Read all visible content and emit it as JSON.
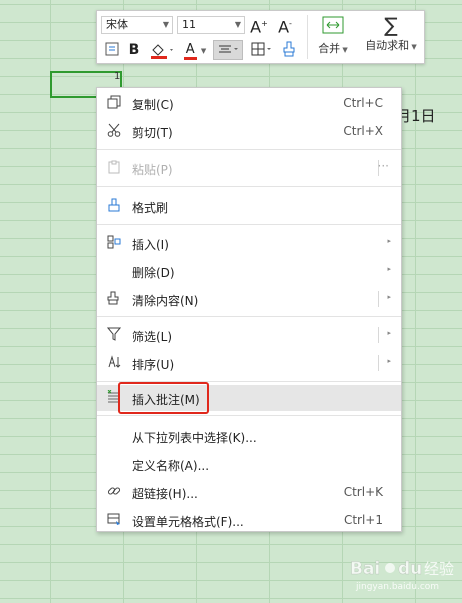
{
  "sheet": {
    "cell_value": "1",
    "visible_text": "月1日"
  },
  "mini_toolbar": {
    "font_name": "宋体",
    "font_size": "11",
    "increase_font": "A",
    "decrease_font": "A",
    "bold": "B",
    "font_color_letter": "A",
    "merge_label": "合并",
    "autosum_label": "自动求和",
    "accent_red": "#e0281c"
  },
  "context_menu": {
    "items": [
      {
        "label": "复制(C)",
        "shortcut": "Ctrl+C",
        "icon": "copy-icon"
      },
      {
        "label": "剪切(T)",
        "shortcut": "Ctrl+X",
        "icon": "cut-icon"
      },
      {
        "label": "粘贴(P)",
        "shortcut": "",
        "icon": "paste-icon",
        "disabled": true
      },
      {
        "label": "格式刷",
        "shortcut": "",
        "icon": "format-painter-icon"
      },
      {
        "label": "插入(I)",
        "shortcut": "",
        "icon": "insert-icon",
        "submenu": true
      },
      {
        "label": "删除(D)",
        "shortcut": "",
        "icon": "",
        "submenu": true
      },
      {
        "label": "清除内容(N)",
        "shortcut": "",
        "icon": "eraser-icon",
        "submenu": true
      },
      {
        "label": "筛选(L)",
        "shortcut": "",
        "icon": "filter-icon",
        "submenu": true
      },
      {
        "label": "排序(U)",
        "shortcut": "",
        "icon": "sort-icon",
        "submenu": true
      },
      {
        "label": "插入批注(M)",
        "shortcut": "",
        "icon": "comment-icon",
        "highlighted": true
      },
      {
        "label": "从下拉列表中选择(K)...",
        "shortcut": "",
        "icon": ""
      },
      {
        "label": "定义名称(A)...",
        "shortcut": "",
        "icon": ""
      },
      {
        "label": "超链接(H)...",
        "shortcut": "Ctrl+K",
        "icon": "link-icon"
      },
      {
        "label": "设置单元格格式(F)...",
        "shortcut": "Ctrl+1",
        "icon": "format-cells-icon"
      }
    ],
    "more_symbol": "···"
  },
  "watermark": {
    "brand": "Baidu",
    "suffix": "经验",
    "url": "jingyan.baidu.com"
  }
}
